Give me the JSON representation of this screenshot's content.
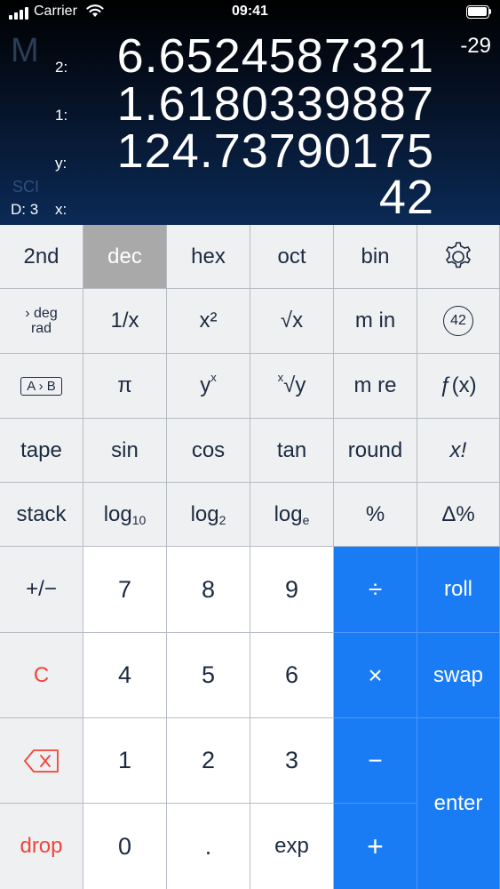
{
  "status": {
    "carrier": "Carrier",
    "time": "09:41"
  },
  "display": {
    "memory_indicator": "M",
    "mode": "SCI",
    "decimals": "D: 3",
    "exponent": "-29",
    "registers": [
      {
        "label": "2:",
        "value": "6.6524587321"
      },
      {
        "label": "1:",
        "value": "1.6180339887"
      },
      {
        "label": "y:",
        "value": "124.73790175"
      },
      {
        "label": "x:",
        "value": "42"
      }
    ]
  },
  "keys": {
    "row1": [
      "2nd",
      "dec",
      "hex",
      "oct",
      "bin"
    ],
    "settings_icon": "gear-icon",
    "deg": "deg",
    "rad": "rad",
    "reciprocal": "1/x",
    "square": "x²",
    "sqrt": "√x",
    "m_in": "m in",
    "badge42": "42",
    "a_to_b": "A › B",
    "pi": "π",
    "power_base": "y",
    "power_exp": "x",
    "root_index": "x",
    "root_body": "√y",
    "m_re": "m re",
    "fx": "ƒ(x)",
    "row4": [
      "tape",
      "sin",
      "cos",
      "tan",
      "round",
      "x!"
    ],
    "stack": "stack",
    "log_word": "log",
    "log10_sub": "10",
    "log2_sub": "2",
    "loge_sub": "e",
    "percent": "%",
    "delta_percent": "Δ%",
    "plus_minus": "+/−",
    "clear": "C",
    "drop": "drop",
    "digits": [
      "7",
      "8",
      "9",
      "4",
      "5",
      "6",
      "1",
      "2",
      "3",
      "0"
    ],
    "dot": ".",
    "exp": "exp",
    "divide": "÷",
    "multiply": "×",
    "minus": "−",
    "plus": "+",
    "roll": "roll",
    "swap": "swap",
    "enter": "enter"
  },
  "colors": {
    "accent": "#1a7cf5",
    "danger": "#f2443a",
    "selected": "#a9a9a9"
  }
}
